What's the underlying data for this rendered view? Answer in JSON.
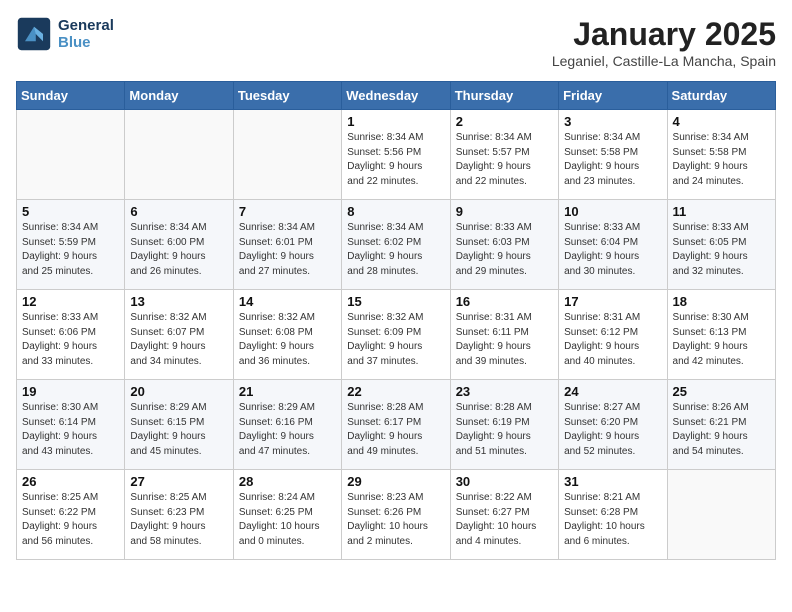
{
  "header": {
    "logo_line1": "General",
    "logo_line2": "Blue",
    "title": "January 2025",
    "subtitle": "Leganiel, Castille-La Mancha, Spain"
  },
  "days_of_week": [
    "Sunday",
    "Monday",
    "Tuesday",
    "Wednesday",
    "Thursday",
    "Friday",
    "Saturday"
  ],
  "weeks": [
    [
      {
        "day": "",
        "info": ""
      },
      {
        "day": "",
        "info": ""
      },
      {
        "day": "",
        "info": ""
      },
      {
        "day": "1",
        "info": "Sunrise: 8:34 AM\nSunset: 5:56 PM\nDaylight: 9 hours\nand 22 minutes."
      },
      {
        "day": "2",
        "info": "Sunrise: 8:34 AM\nSunset: 5:57 PM\nDaylight: 9 hours\nand 22 minutes."
      },
      {
        "day": "3",
        "info": "Sunrise: 8:34 AM\nSunset: 5:58 PM\nDaylight: 9 hours\nand 23 minutes."
      },
      {
        "day": "4",
        "info": "Sunrise: 8:34 AM\nSunset: 5:58 PM\nDaylight: 9 hours\nand 24 minutes."
      }
    ],
    [
      {
        "day": "5",
        "info": "Sunrise: 8:34 AM\nSunset: 5:59 PM\nDaylight: 9 hours\nand 25 minutes."
      },
      {
        "day": "6",
        "info": "Sunrise: 8:34 AM\nSunset: 6:00 PM\nDaylight: 9 hours\nand 26 minutes."
      },
      {
        "day": "7",
        "info": "Sunrise: 8:34 AM\nSunset: 6:01 PM\nDaylight: 9 hours\nand 27 minutes."
      },
      {
        "day": "8",
        "info": "Sunrise: 8:34 AM\nSunset: 6:02 PM\nDaylight: 9 hours\nand 28 minutes."
      },
      {
        "day": "9",
        "info": "Sunrise: 8:33 AM\nSunset: 6:03 PM\nDaylight: 9 hours\nand 29 minutes."
      },
      {
        "day": "10",
        "info": "Sunrise: 8:33 AM\nSunset: 6:04 PM\nDaylight: 9 hours\nand 30 minutes."
      },
      {
        "day": "11",
        "info": "Sunrise: 8:33 AM\nSunset: 6:05 PM\nDaylight: 9 hours\nand 32 minutes."
      }
    ],
    [
      {
        "day": "12",
        "info": "Sunrise: 8:33 AM\nSunset: 6:06 PM\nDaylight: 9 hours\nand 33 minutes."
      },
      {
        "day": "13",
        "info": "Sunrise: 8:32 AM\nSunset: 6:07 PM\nDaylight: 9 hours\nand 34 minutes."
      },
      {
        "day": "14",
        "info": "Sunrise: 8:32 AM\nSunset: 6:08 PM\nDaylight: 9 hours\nand 36 minutes."
      },
      {
        "day": "15",
        "info": "Sunrise: 8:32 AM\nSunset: 6:09 PM\nDaylight: 9 hours\nand 37 minutes."
      },
      {
        "day": "16",
        "info": "Sunrise: 8:31 AM\nSunset: 6:11 PM\nDaylight: 9 hours\nand 39 minutes."
      },
      {
        "day": "17",
        "info": "Sunrise: 8:31 AM\nSunset: 6:12 PM\nDaylight: 9 hours\nand 40 minutes."
      },
      {
        "day": "18",
        "info": "Sunrise: 8:30 AM\nSunset: 6:13 PM\nDaylight: 9 hours\nand 42 minutes."
      }
    ],
    [
      {
        "day": "19",
        "info": "Sunrise: 8:30 AM\nSunset: 6:14 PM\nDaylight: 9 hours\nand 43 minutes."
      },
      {
        "day": "20",
        "info": "Sunrise: 8:29 AM\nSunset: 6:15 PM\nDaylight: 9 hours\nand 45 minutes."
      },
      {
        "day": "21",
        "info": "Sunrise: 8:29 AM\nSunset: 6:16 PM\nDaylight: 9 hours\nand 47 minutes."
      },
      {
        "day": "22",
        "info": "Sunrise: 8:28 AM\nSunset: 6:17 PM\nDaylight: 9 hours\nand 49 minutes."
      },
      {
        "day": "23",
        "info": "Sunrise: 8:28 AM\nSunset: 6:19 PM\nDaylight: 9 hours\nand 51 minutes."
      },
      {
        "day": "24",
        "info": "Sunrise: 8:27 AM\nSunset: 6:20 PM\nDaylight: 9 hours\nand 52 minutes."
      },
      {
        "day": "25",
        "info": "Sunrise: 8:26 AM\nSunset: 6:21 PM\nDaylight: 9 hours\nand 54 minutes."
      }
    ],
    [
      {
        "day": "26",
        "info": "Sunrise: 8:25 AM\nSunset: 6:22 PM\nDaylight: 9 hours\nand 56 minutes."
      },
      {
        "day": "27",
        "info": "Sunrise: 8:25 AM\nSunset: 6:23 PM\nDaylight: 9 hours\nand 58 minutes."
      },
      {
        "day": "28",
        "info": "Sunrise: 8:24 AM\nSunset: 6:25 PM\nDaylight: 10 hours\nand 0 minutes."
      },
      {
        "day": "29",
        "info": "Sunrise: 8:23 AM\nSunset: 6:26 PM\nDaylight: 10 hours\nand 2 minutes."
      },
      {
        "day": "30",
        "info": "Sunrise: 8:22 AM\nSunset: 6:27 PM\nDaylight: 10 hours\nand 4 minutes."
      },
      {
        "day": "31",
        "info": "Sunrise: 8:21 AM\nSunset: 6:28 PM\nDaylight: 10 hours\nand 6 minutes."
      },
      {
        "day": "",
        "info": ""
      }
    ]
  ]
}
